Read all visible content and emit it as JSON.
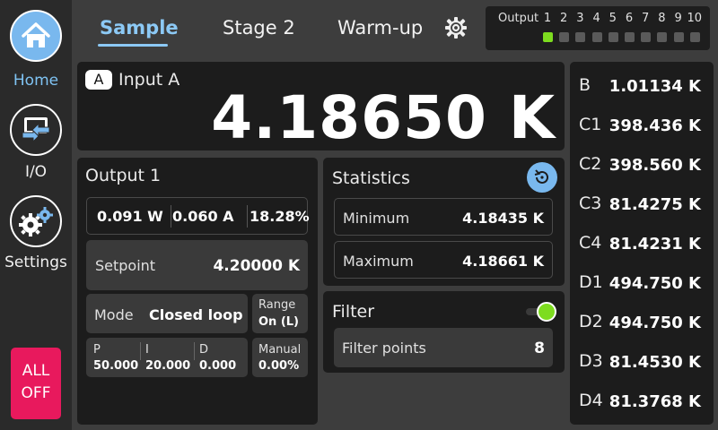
{
  "sidebar": {
    "items": [
      {
        "label": "Home",
        "icon": "home-icon",
        "active": true
      },
      {
        "label": "I/O",
        "icon": "io-icon",
        "active": false
      },
      {
        "label": "Settings",
        "icon": "settings-icon",
        "active": false
      }
    ],
    "all_off": {
      "line1": "ALL",
      "line2": "OFF"
    }
  },
  "tabs": [
    {
      "label": "Sample",
      "active": true
    },
    {
      "label": "Stage 2",
      "active": false
    },
    {
      "label": "Warm-up",
      "active": false
    }
  ],
  "outputs": {
    "label": "Output",
    "numbers": [
      "1",
      "2",
      "3",
      "4",
      "5",
      "6",
      "7",
      "8",
      "9",
      "10"
    ],
    "active_index": 0
  },
  "input_a": {
    "badge": "A",
    "name": "Input A",
    "value": "4.18650 K"
  },
  "output1": {
    "title": "Output 1",
    "power": "0.091 W",
    "current": "0.060 A",
    "percent": "18.28%",
    "setpoint_label": "Setpoint",
    "setpoint_value": "4.20000 K",
    "mode_label": "Mode",
    "mode_value": "Closed loop",
    "range_label": "Range",
    "range_value": "On (L)",
    "p_label": "P",
    "p_value": "50.000",
    "i_label": "I",
    "i_value": "20.000",
    "d_label": "D",
    "d_value": "0.000",
    "manual_label": "Manual",
    "manual_value": "0.00%"
  },
  "statistics": {
    "title": "Statistics",
    "min_label": "Minimum",
    "min_value": "4.18435 K",
    "max_label": "Maximum",
    "max_value": "4.18661 K"
  },
  "filter": {
    "title": "Filter",
    "enabled": true,
    "points_label": "Filter points",
    "points_value": "8"
  },
  "channels": [
    {
      "name": "B",
      "value": "1.01134 K"
    },
    {
      "name": "C1",
      "value": "398.436 K"
    },
    {
      "name": "C2",
      "value": "398.560 K"
    },
    {
      "name": "C3",
      "value": "81.4275 K"
    },
    {
      "name": "C4",
      "value": "81.4231 K"
    },
    {
      "name": "D1",
      "value": "494.750 K"
    },
    {
      "name": "D2",
      "value": "494.750 K"
    },
    {
      "name": "D3",
      "value": "81.4530 K"
    },
    {
      "name": "D4",
      "value": "81.3768 K"
    }
  ],
  "colors": {
    "accent": "#8cc9f5",
    "alloff": "#e8195d",
    "led_on": "#7ddc1f"
  }
}
